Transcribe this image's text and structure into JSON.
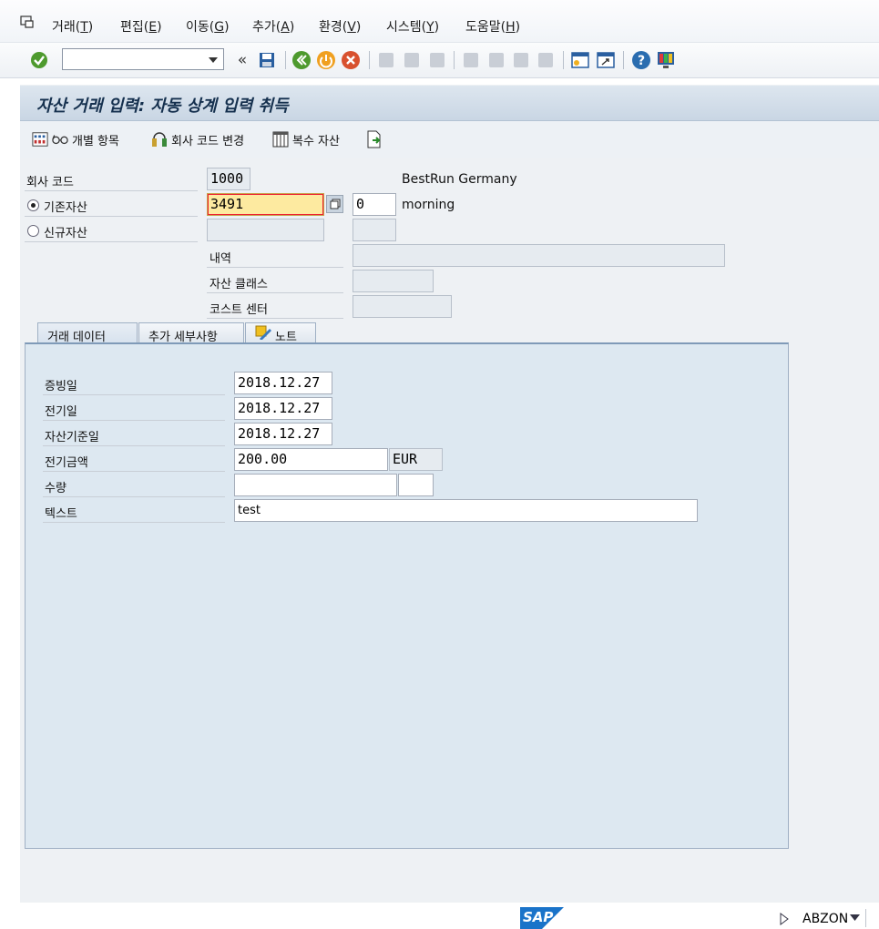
{
  "menu": {
    "items": [
      {
        "label": "거래",
        "key": "T"
      },
      {
        "label": "편집",
        "key": "E"
      },
      {
        "label": "이동",
        "key": "G"
      },
      {
        "label": "추가",
        "key": "A"
      },
      {
        "label": "환경",
        "key": "V"
      },
      {
        "label": "시스템",
        "key": "Y"
      },
      {
        "label": "도움말",
        "key": "H"
      }
    ]
  },
  "toolbar": {
    "command_value": "",
    "back_glyph": "«"
  },
  "screen": {
    "title": "자산 거래 입력: 자동 상계 입력 취득"
  },
  "app_toolbar": {
    "individual_items": "개별 항목",
    "change_company_code": "회사 코드 변경",
    "multiple_assets": "복수 자산"
  },
  "header": {
    "company_code_label": "회사 코드",
    "company_code_value": "1000",
    "company_name": "BestRun Germany",
    "existing_asset_label": "기존자산",
    "existing_asset_value": "3491",
    "sub_number_value": "0",
    "asset_name": "morning",
    "new_asset_label": "신규자산",
    "description_label": "내역",
    "asset_class_label": "자산 클래스",
    "cost_center_label": "코스트 센터"
  },
  "tabs": [
    {
      "label": "거래 데이터",
      "active": true
    },
    {
      "label": "추가 세부사항",
      "active": false
    },
    {
      "label": "노트",
      "active": false
    }
  ],
  "transaction": {
    "document_date_label": "증빙일",
    "document_date": "2018.12.27",
    "posting_date_label": "전기일",
    "posting_date": "2018.12.27",
    "asset_value_date_label": "자산기준일",
    "asset_value_date": "2018.12.27",
    "amount_label": "전기금액",
    "amount": "200.00",
    "currency": "EUR",
    "quantity_label": "수량",
    "quantity": "",
    "unit": "",
    "text_label": "텍스트",
    "text": "test"
  },
  "footer": {
    "logo_text": "SAP",
    "system": "ABZON"
  }
}
